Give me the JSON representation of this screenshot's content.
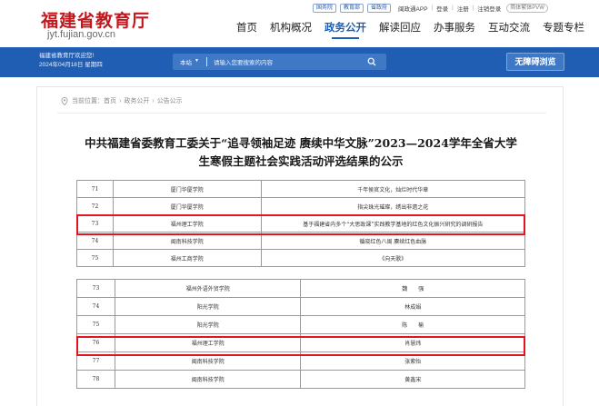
{
  "site": {
    "logo_text": "福建省教育厅",
    "domain": "jyt.fujian.gov.cn"
  },
  "top_links": {
    "pills": [
      "国务院",
      "教育部",
      "省政府"
    ],
    "app": "闽政通APP",
    "login": "登录",
    "register": "注册",
    "unregister": "注销登录",
    "pvw": "简体繁体PVW",
    "separator": "|"
  },
  "nav": {
    "items": [
      "首页",
      "机构概况",
      "政务公开",
      "解读回应",
      "办事服务",
      "互动交流",
      "专题专栏"
    ],
    "active": "政务公开"
  },
  "banner": {
    "welcome": "福建省教育厅欢迎您!",
    "date": "2024年04月18日 星期四",
    "search_scope": "本站",
    "search_caret": "▼",
    "search_placeholder": "请输入您要搜索的内容",
    "accessibility": "无障碍浏览"
  },
  "breadcrumb": {
    "label": "当前位置：",
    "items": [
      "首页",
      "政务公开",
      "公告公示"
    ],
    "separator": "›"
  },
  "article": {
    "title_line1": "中共福建省委教育工委关于“追寻领袖足迹 赓续中华文脉”2023—2024学年全省大学",
    "title_line2": "生寒假主题社会实践活动评选结果的公示"
  },
  "table1": [
    [
      "71",
      "厦门华厦学院",
      "千年侯官文化，灿烂时代华章"
    ],
    [
      "72",
      "厦门华厦学院",
      "指尖珠光璀璨，绣出非遗之花"
    ],
    [
      "73",
      "福州理工学院",
      "基于福建省内多个“大思政课”实践教学基地的红色文化振兴研究的调研报告"
    ],
    [
      "74",
      "闽南科技学院",
      "循晓红色八闽 赓续红色血脉"
    ],
    [
      "75",
      "福州工商学院",
      "《向天歌》"
    ]
  ],
  "table2": [
    [
      "73",
      "福州外语外贸学院",
      "魏　　强"
    ],
    [
      "74",
      "阳光学院",
      "林成娟"
    ],
    [
      "75",
      "阳光学院",
      "陈　　榆"
    ],
    [
      "76",
      "福州理工学院",
      "肖慧炜"
    ],
    [
      "77",
      "闽南科技学院",
      "张紫怡"
    ],
    [
      "78",
      "闽南科技学院",
      "黄鑫宋"
    ]
  ],
  "colors": {
    "brand_red": "#c4171d",
    "nav_blue": "#1d5fb4",
    "banner_blue": "#1f5eb3",
    "highlight_red": "#e0151f"
  }
}
